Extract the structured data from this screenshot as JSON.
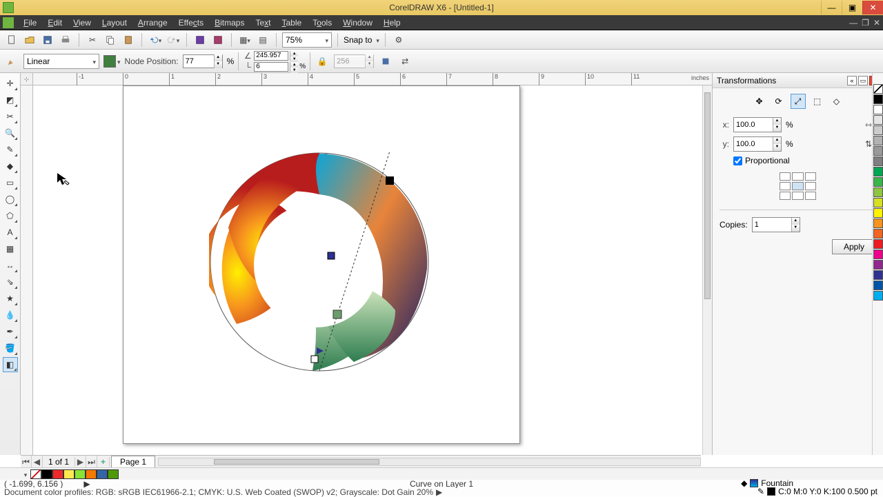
{
  "title": "CorelDRAW X6 - [Untitled-1]",
  "menus": [
    "File",
    "Edit",
    "View",
    "Layout",
    "Arrange",
    "Effects",
    "Bitmaps",
    "Text",
    "Table",
    "Tools",
    "Window",
    "Help"
  ],
  "toolbar": {
    "zoom": "75%",
    "snap": "Snap to"
  },
  "propbar": {
    "fill_type": "Linear",
    "node_position_label": "Node Position:",
    "node_position": "77",
    "node_unit": "%",
    "width": "245.957",
    "height": "6",
    "wh_unit": "%",
    "steps": "256"
  },
  "ruler": {
    "units": "inches",
    "ticks": [
      -1,
      0,
      1,
      2,
      3,
      4,
      5,
      6,
      7,
      8,
      9,
      10,
      11
    ]
  },
  "docker": {
    "title": "Transformations",
    "x": "100.0",
    "y": "100.0",
    "unit": "%",
    "proportional_label": "Proportional",
    "proportional": true,
    "copies_label": "Copies:",
    "copies": "1",
    "apply": "Apply"
  },
  "palette_colors": [
    "#000000",
    "#ffffff",
    "#e5e5e5",
    "#cccccc",
    "#b2b2b2",
    "#999999",
    "#7f7f7f",
    "#00a651",
    "#39b54a",
    "#8dc63f",
    "#d7df23",
    "#fff200",
    "#f7941e",
    "#f26522",
    "#ed1c24",
    "#ec008c",
    "#92278f",
    "#2e3192",
    "#0054a6",
    "#00aeef"
  ],
  "mini_palette": [
    "#000000",
    "#ef2929",
    "#fce94f",
    "#8ae234",
    "#f57900",
    "#3465a4",
    "#4e9a06"
  ],
  "pages": {
    "count": "1 of 1",
    "tab": "Page 1"
  },
  "status": {
    "coords": "( -1.699, 6.156 )",
    "object": "Curve on Layer 1",
    "fill_label": "Fountain",
    "outline": "C:0 M:0 Y:0 K:100  0.500 pt",
    "profiles": "Document color profiles: RGB: sRGB IEC61966-2.1; CMYK: U.S. Web Coated (SWOP) v2; Grayscale: Dot Gain 20%"
  }
}
